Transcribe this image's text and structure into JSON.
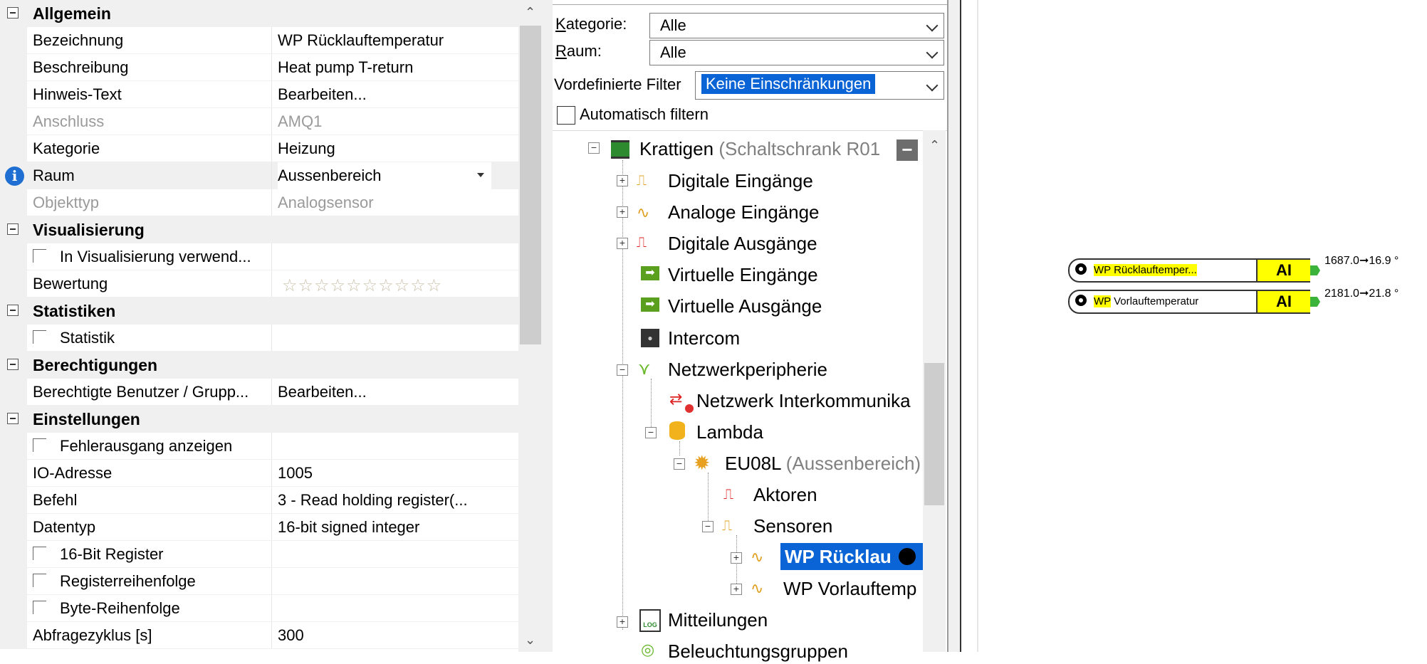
{
  "properties": {
    "sections": {
      "allgemein": "Allgemein",
      "visualisierung": "Visualisierung",
      "statistiken": "Statistiken",
      "berechtigungen": "Berechtigungen",
      "einstellungen": "Einstellungen"
    },
    "rows": {
      "bezeichnung": {
        "name": "Bezeichnung",
        "value": "WP Rücklauftemperatur"
      },
      "beschreibung": {
        "name": "Beschreibung",
        "value": "Heat pump T-return"
      },
      "hinweis": {
        "name": "Hinweis-Text",
        "value": "Bearbeiten..."
      },
      "anschluss": {
        "name": "Anschluss",
        "value": "AMQ1"
      },
      "kategorie": {
        "name": "Kategorie",
        "value": "Heizung"
      },
      "raum": {
        "name": "Raum",
        "value": "Aussenbereich"
      },
      "objekttyp": {
        "name": "Objekttyp",
        "value": "Analogsensor"
      },
      "visu": {
        "name": "In Visualisierung verwend..."
      },
      "bewertung": {
        "name": "Bewertung",
        "value": "☆☆☆☆☆☆☆☆☆☆"
      },
      "statistik": {
        "name": "Statistik"
      },
      "benutzer": {
        "name": "Berechtigte Benutzer / Grupp...",
        "value": "Bearbeiten..."
      },
      "fehler": {
        "name": "Fehlerausgang anzeigen"
      },
      "io": {
        "name": "IO-Adresse",
        "value": "1005"
      },
      "befehl": {
        "name": "Befehl",
        "value": "3 - Read holding register(..."
      },
      "datentyp": {
        "name": "Datentyp",
        "value": "16-bit signed integer"
      },
      "bit16": {
        "name": "16-Bit Register"
      },
      "regfolge": {
        "name": "Registerreihenfolge"
      },
      "bytefolge": {
        "name": "Byte-Reihenfolge"
      },
      "abfrage": {
        "name": "Abfragezyklus [s]",
        "value": "300"
      }
    }
  },
  "filters": {
    "kategorie_label_u": "K",
    "kategorie_label_rest": "ategorie:",
    "kategorie_value": "Alle",
    "raum_label_u": "R",
    "raum_label_rest": "aum:",
    "raum_value": "Alle",
    "vordef_label": "Vordefinierte Filter",
    "vordef_value": "Keine Einschränkungen",
    "auto_label": "Automatisch filtern"
  },
  "tree": {
    "krattigen": "Krattigen",
    "krattigen_sub": "(Schaltschrank R01",
    "digitale_eingaenge": "Digitale Eingänge",
    "analoge_eingaenge": "Analoge Eingänge",
    "digitale_ausgaenge": "Digitale Ausgänge",
    "virtuelle_eingaenge": "Virtuelle Eingänge",
    "virtuelle_ausgaenge": "Virtuelle Ausgänge",
    "intercom": "Intercom",
    "netzwerkperipherie": "Netzwerkperipherie",
    "netzwerk_inter": "Netzwerk Interkommunika",
    "lambda": "Lambda",
    "eu08l": "EU08L",
    "eu08l_sub": "(Aussenbereich)",
    "aktoren": "Aktoren",
    "sensoren": "Sensoren",
    "wp_rueck": "WP Rücklau",
    "wp_vorlauf": "WP Vorlauftemp",
    "mitteilungen": "Mitteilungen",
    "beleuchtung": "Beleuchtungsgruppen"
  },
  "canvas": {
    "block1": {
      "name_hl": "WP",
      "name_rest": " Rücklauftemper...",
      "type": "AI",
      "output": "1687.0➞16.9 °"
    },
    "block2": {
      "name_hl": "WP",
      "name_rest": " Vorlauftemperatur",
      "type": "AI",
      "output": "2181.0➞21.8 °"
    }
  },
  "colors": {
    "selection": "#0a64d6",
    "block_yellow": "#ffff00",
    "info_blue": "#1e6fd1"
  }
}
